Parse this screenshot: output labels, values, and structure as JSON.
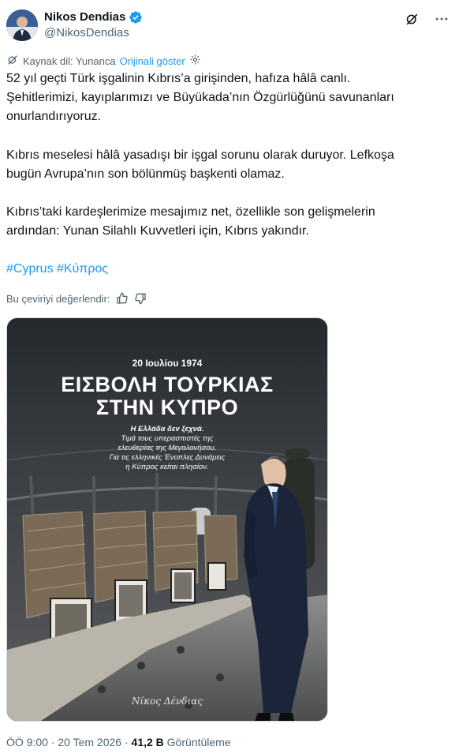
{
  "author": {
    "display_name": "Nikos Dendias",
    "handle": "@NikosDendias"
  },
  "translation": {
    "source_label": "Kaynak dil: Yunanca",
    "show_original": "Orijinali göster"
  },
  "tweet": {
    "para1_line1": "52 yıl geçti Türk işgalinin Kıbrıs’a girişinden, hafıza hâlâ canlı.",
    "para1_line2": "Şehitlerimizi, kayıplarımızı ve Büyükada’nın Özgürlüğünü savunanları",
    "para1_line3": "onurlandırıyoruz.",
    "para2_line1": "Kıbrıs meselesi hâlâ yasadışı bir işgal sorunu olarak duruyor. Lefkoşa",
    "para2_line2": "bugün Avrupa’nın son bölünmüş başkenti olamaz.",
    "para3_line1": "Kıbrıs’taki kardeşlerimize mesajımız net, özellikle son gelişmelerin",
    "para3_line2": "ardından: Yunan Silahlı Kuvvetleri için, Kıbrıs yakındır.",
    "hashtag1": "#Cyprus",
    "hashtag2": "#Κύπρος"
  },
  "rating": {
    "label": "Bu çeviriyi değerlendir:"
  },
  "poster": {
    "date": "20 Ιουλίου 1974",
    "title_line1": "ΕΙΣΒΟΛΗ ΤΟΥΡΚΙΑΣ",
    "title_line2": "ΣΤΗΝ ΚΥΠΡΟ",
    "sub_line1": "Η Ελλάδα δεν ξεχνά.",
    "sub_line2": "Τιμά τους υπερασπιστές της",
    "sub_line3": "ελευθερίας της Μεγαλονήσου.",
    "sub_line4": "Για τις ελληνικές Ένοπλες Δυνάμεις",
    "sub_line5": "η Κύπρος κείται πλησίον.",
    "signature": "Νίκος Δένδιας"
  },
  "meta": {
    "time": "ÖÖ 9:00",
    "sep1": " · ",
    "date": "20 Tem 2026",
    "sep2": " · ",
    "views": "41,2 B",
    "views_label": " Görüntüleme"
  },
  "colors": {
    "accent": "#1d9bf0",
    "secondary_text": "#536471",
    "primary_text": "#0f1419"
  },
  "icons": [
    "verified-badge-icon",
    "grok-icon",
    "more-icon",
    "translate-icon",
    "settings-icon",
    "thumbs-up-icon",
    "thumbs-down-icon"
  ]
}
